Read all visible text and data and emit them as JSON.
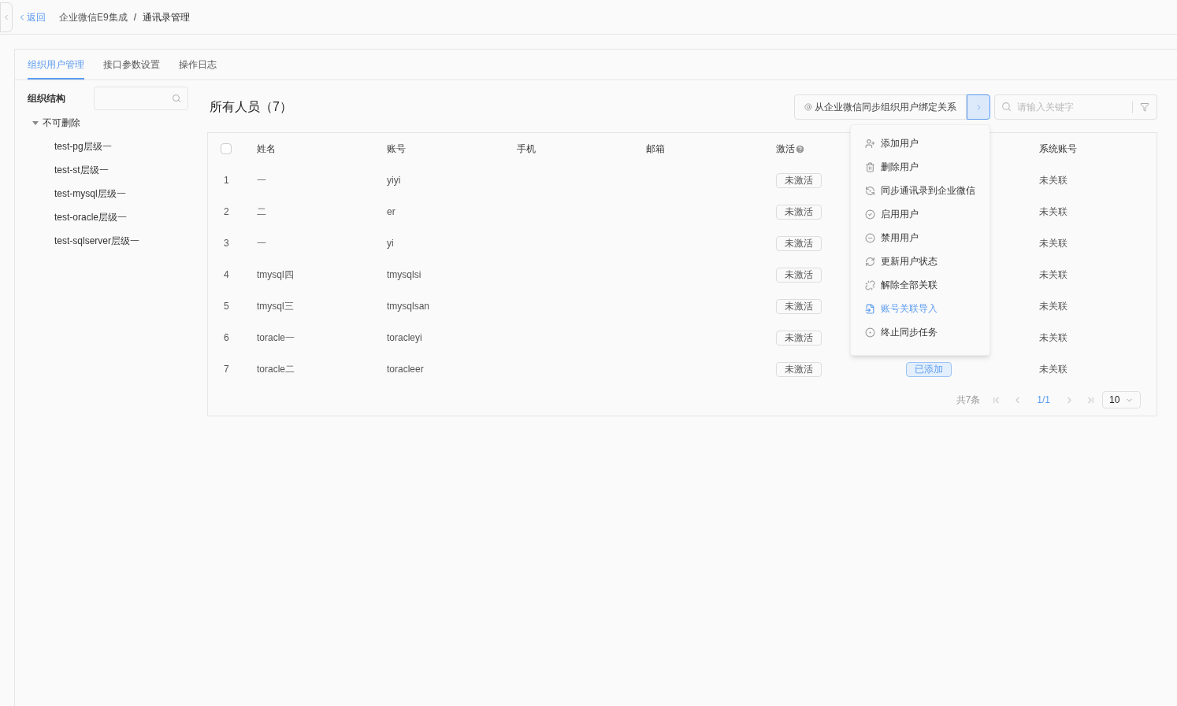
{
  "breadcrumb": {
    "back": "返回",
    "items": [
      "企业微信E9集成",
      "通讯录管理"
    ],
    "separator": "/"
  },
  "tabs": [
    {
      "label": "组织用户管理",
      "selected": true
    },
    {
      "label": "接口参数设置",
      "selected": false
    },
    {
      "label": "操作日志",
      "selected": false
    }
  ],
  "org_tree": {
    "title": "组织结构",
    "root": {
      "label": "不可删除",
      "expanded": true,
      "children": [
        {
          "label": "test-pg层级一"
        },
        {
          "label": "test-st层级一"
        },
        {
          "label": "test-mysql层级一"
        },
        {
          "label": "test-oracle层级一"
        },
        {
          "label": "test-sqlserver层级一"
        }
      ]
    }
  },
  "list": {
    "title": "所有人员（7）",
    "sync_button": "从企业微信同步组织用户绑定关系",
    "search": {
      "placeholder": "请输入关键字"
    },
    "menu": [
      {
        "label": "添加用户",
        "highlighted": false
      },
      {
        "label": "删除用户",
        "highlighted": false
      },
      {
        "label": "同步通讯录到企业微信",
        "highlighted": false
      },
      {
        "label": "启用用户",
        "highlighted": false
      },
      {
        "label": "禁用用户",
        "highlighted": false
      },
      {
        "label": "更新用户状态",
        "highlighted": false
      },
      {
        "label": "解除全部关联",
        "highlighted": false
      },
      {
        "label": "账号关联导入",
        "highlighted": true
      },
      {
        "label": "终止同步任务",
        "highlighted": false
      }
    ],
    "table": {
      "select_all": {
        "checked": false
      },
      "columns": [
        "姓名",
        "账号",
        "手机",
        "邮箱",
        "激活",
        "系统账号"
      ],
      "rows": [
        {
          "index": "1",
          "name": "一",
          "account": "yiyi",
          "activation": "未激活",
          "system_account": "未关联"
        },
        {
          "index": "2",
          "name": "二",
          "account": "er",
          "activation": "未激活",
          "system_account": "未关联"
        },
        {
          "index": "3",
          "name": "一",
          "account": "yi",
          "activation": "未激活",
          "system_account": "未关联"
        },
        {
          "index": "4",
          "name": "tmysql四",
          "account": "tmysqlsi",
          "activation": "未激活",
          "system_account": "未关联"
        },
        {
          "index": "5",
          "name": "tmysql三",
          "account": "tmysqlsan",
          "activation": "未激活",
          "system_account": "未关联"
        },
        {
          "index": "6",
          "name": "toracle一",
          "account": "toracleyi",
          "activation": "未激活",
          "system_account": "未关联"
        },
        {
          "index": "7",
          "name": "toracle二",
          "account": "toracleer",
          "activation": "未激活",
          "column_6": "已添加",
          "system_account": "未关联"
        }
      ]
    },
    "pagination": {
      "total": "共7条",
      "page": "1/1",
      "page_size": "10"
    }
  }
}
